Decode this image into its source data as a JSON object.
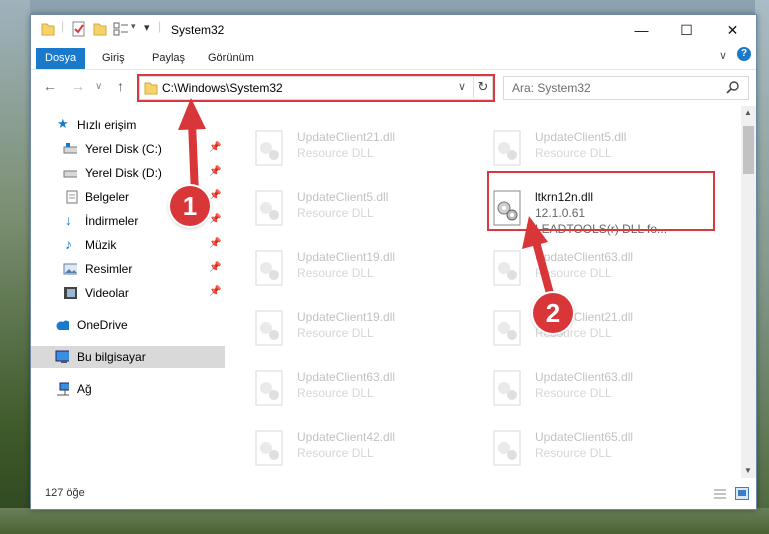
{
  "window": {
    "title": "System32"
  },
  "ribbon": {
    "tabs": [
      "Dosya",
      "Giriş",
      "Paylaş",
      "Görünüm"
    ]
  },
  "address": {
    "path": "C:\\Windows\\System32"
  },
  "search": {
    "placeholder": "Ara: System32"
  },
  "sidebar": {
    "items": [
      {
        "label": "Hızlı erişim",
        "icon": "star-icon"
      },
      {
        "label": "Yerel Disk (C:)",
        "icon": "drive-icon"
      },
      {
        "label": "Yerel Disk (D:)",
        "icon": "drive-icon"
      },
      {
        "label": "Belgeler",
        "icon": "documents-icon"
      },
      {
        "label": "İndirmeler",
        "icon": "download-icon"
      },
      {
        "label": "Müzik",
        "icon": "music-icon"
      },
      {
        "label": "Resimler",
        "icon": "pictures-icon"
      },
      {
        "label": "Videolar",
        "icon": "video-icon"
      },
      {
        "label": "OneDrive",
        "icon": "cloud-icon"
      },
      {
        "label": "Bu bilgisayar",
        "icon": "computer-icon"
      },
      {
        "label": "Ağ",
        "icon": "network-icon"
      }
    ]
  },
  "files": [
    {
      "name": "UpdateClient21.dll",
      "desc": "Resource DLL"
    },
    {
      "name": "UpdateClient5.dll",
      "desc": "Resource DLL"
    },
    {
      "name": "UpdateClient5.dll",
      "desc": "Resource DLL"
    },
    {
      "name": "ltkrn12n.dll",
      "version": "12.1.0.61",
      "desc": "LEADTOOLS(r) DLL fo..."
    },
    {
      "name": "UpdateClient19.dll",
      "desc": "Resource DLL"
    },
    {
      "name": "UpdateClient63.dll",
      "desc": "Resource DLL"
    },
    {
      "name": "UpdateClient19.dll",
      "desc": "Resource DLL"
    },
    {
      "name": "UpdateClient21.dll",
      "desc": "Resource DLL"
    },
    {
      "name": "UpdateClient63.dll",
      "desc": "Resource DLL"
    },
    {
      "name": "UpdateClient63.dll",
      "desc": "Resource DLL"
    },
    {
      "name": "UpdateClient42.dll",
      "desc": "Resource DLL"
    },
    {
      "name": "UpdateClient65.dll",
      "desc": "Resource DLL"
    }
  ],
  "status": {
    "count": "127 öğe"
  },
  "callouts": [
    "1",
    "2"
  ],
  "colors": {
    "accent": "#1979ca",
    "highlight": "#d7393e"
  }
}
